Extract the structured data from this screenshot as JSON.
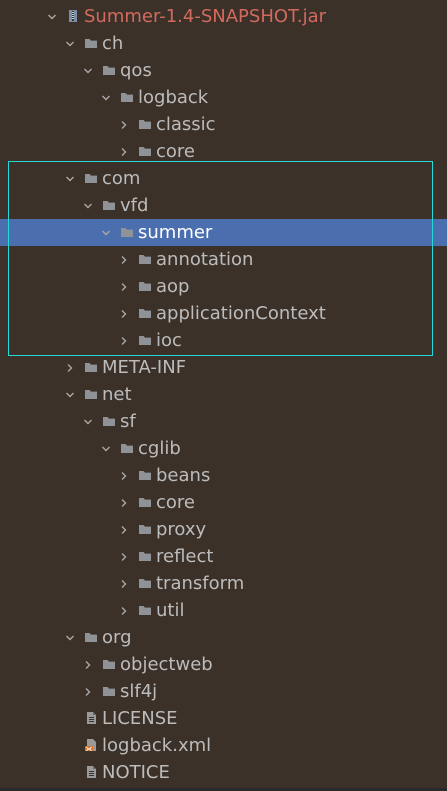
{
  "tree": [
    {
      "label": "Summer-1.4-SNAPSHOT.jar",
      "depth": 0,
      "chevron": "expanded",
      "icon": "jar-icon",
      "root": true
    },
    {
      "label": "ch",
      "depth": 1,
      "chevron": "expanded",
      "icon": "folder-icon"
    },
    {
      "label": "qos",
      "depth": 2,
      "chevron": "expanded",
      "icon": "folder-icon"
    },
    {
      "label": "logback",
      "depth": 3,
      "chevron": "expanded",
      "icon": "folder-icon"
    },
    {
      "label": "classic",
      "depth": 4,
      "chevron": "collapsed",
      "icon": "folder-icon"
    },
    {
      "label": "core",
      "depth": 4,
      "chevron": "collapsed",
      "icon": "folder-icon"
    },
    {
      "label": "com",
      "depth": 1,
      "chevron": "expanded",
      "icon": "folder-icon"
    },
    {
      "label": "vfd",
      "depth": 2,
      "chevron": "expanded",
      "icon": "folder-icon"
    },
    {
      "label": "summer",
      "depth": 3,
      "chevron": "expanded",
      "icon": "folder-icon",
      "selected": true
    },
    {
      "label": "annotation",
      "depth": 4,
      "chevron": "collapsed",
      "icon": "folder-icon"
    },
    {
      "label": "aop",
      "depth": 4,
      "chevron": "collapsed",
      "icon": "folder-icon"
    },
    {
      "label": "applicationContext",
      "depth": 4,
      "chevron": "collapsed",
      "icon": "folder-icon"
    },
    {
      "label": "ioc",
      "depth": 4,
      "chevron": "collapsed",
      "icon": "folder-icon"
    },
    {
      "label": "META-INF",
      "depth": 1,
      "chevron": "collapsed",
      "icon": "folder-icon"
    },
    {
      "label": "net",
      "depth": 1,
      "chevron": "expanded",
      "icon": "folder-icon"
    },
    {
      "label": "sf",
      "depth": 2,
      "chevron": "expanded",
      "icon": "folder-icon"
    },
    {
      "label": "cglib",
      "depth": 3,
      "chevron": "expanded",
      "icon": "folder-icon"
    },
    {
      "label": "beans",
      "depth": 4,
      "chevron": "collapsed",
      "icon": "folder-icon"
    },
    {
      "label": "core",
      "depth": 4,
      "chevron": "collapsed",
      "icon": "folder-icon"
    },
    {
      "label": "proxy",
      "depth": 4,
      "chevron": "collapsed",
      "icon": "folder-icon"
    },
    {
      "label": "reflect",
      "depth": 4,
      "chevron": "collapsed",
      "icon": "folder-icon"
    },
    {
      "label": "transform",
      "depth": 4,
      "chevron": "collapsed",
      "icon": "folder-icon"
    },
    {
      "label": "util",
      "depth": 4,
      "chevron": "collapsed",
      "icon": "folder-icon"
    },
    {
      "label": "org",
      "depth": 1,
      "chevron": "expanded",
      "icon": "folder-icon"
    },
    {
      "label": "objectweb",
      "depth": 2,
      "chevron": "collapsed",
      "icon": "folder-icon"
    },
    {
      "label": "slf4j",
      "depth": 2,
      "chevron": "collapsed",
      "icon": "folder-icon"
    },
    {
      "label": "LICENSE",
      "depth": 1,
      "chevron": "none",
      "icon": "text-file-icon"
    },
    {
      "label": "logback.xml",
      "depth": 1,
      "chevron": "none",
      "icon": "xml-file-icon"
    },
    {
      "label": "NOTICE",
      "depth": 1,
      "chevron": "none",
      "icon": "text-file-icon"
    }
  ],
  "colors": {
    "background": "#3b3129",
    "text": "#bcbcbc",
    "root_text": "#d36a5f",
    "selected_bg": "#4b6eaf",
    "selected_text": "#ffffff",
    "folder": "#8f9398",
    "highlight_box": "#26d9d9"
  }
}
